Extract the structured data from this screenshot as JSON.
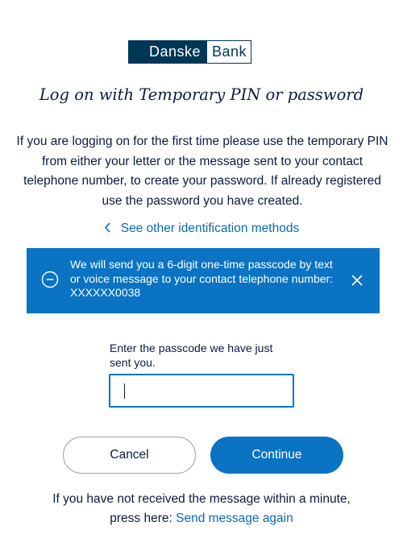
{
  "logo": {
    "left_text": "Danske",
    "right_text": "Bank"
  },
  "title": "Log on with  Temporary PIN or password",
  "intro": "If you are logging on for the first time please use the temporary PIN from either your letter or the message sent to your contact telephone number, to create your password. If already registered use the password you have created.",
  "other_methods": {
    "icon": "chevron-left-icon",
    "label": "See other identification methods"
  },
  "info_box": {
    "icon": "minus-circle-icon",
    "text": "We will send you a 6-digit one-time passcode by text or voice message to your contact telephone number: XXXXXX0038",
    "close_icon": "close-icon"
  },
  "passcode": {
    "label": "Enter the passcode we have just sent you.",
    "value": "",
    "placeholder": ""
  },
  "buttons": {
    "cancel": "Cancel",
    "continue": "Continue"
  },
  "resend": {
    "text": "If you have not received the message within a minute, press here:",
    "link": "Send message again"
  },
  "colors": {
    "brand_dark": "#003755",
    "accent_blue": "#0a73c3",
    "link_blue": "#0a69b5",
    "text": "#0d1b3e"
  }
}
